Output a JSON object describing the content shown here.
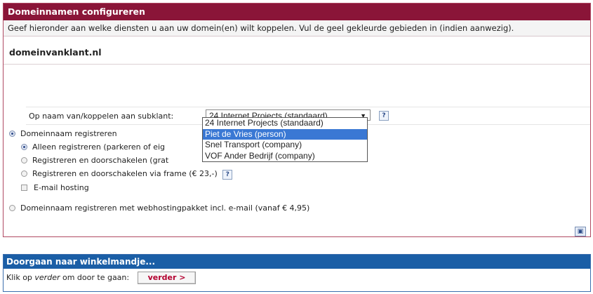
{
  "config": {
    "title": "Domeinnamen configureren",
    "intro": "Geef hieronder aan welke diensten u aan uw domein(en) wilt koppelen. Vul de geel gekleurde gebieden in (indien aanwezig).",
    "domain": "domeinvanklant.nl",
    "subclient_label": "Op naam van/koppelen aan subklant:",
    "subclient_selected": "24 Internet Projects (standaard)",
    "subclient_options": [
      "24 Internet Projects (standaard)",
      "Piet de Vries (person)",
      "Snel Transport (company)",
      "VOF Ander Bedrijf (company)"
    ],
    "help_glyph": "?",
    "opt_register": "Domeinnaam registreren",
    "opt_park": "Alleen registreren (parkeren of eig",
    "opt_forward": "Registreren en doorschakelen (grat",
    "opt_frame": "Registreren en doorschakelen via frame (€ 23,-)",
    "opt_email": "E-mail hosting",
    "opt_hosting": "Domeinnaam registreren met webhostingpakket incl. e-mail (vanaf € 4,95)"
  },
  "cart": {
    "title": "Doorgaan naar winkelmandje...",
    "text_before": "Klik op ",
    "text_em": "verder",
    "text_after": " om door te gaan:",
    "button": "verder >"
  },
  "colors": {
    "config_header": "#8a1538",
    "cart_header": "#1a5ea6",
    "highlight": "#3a78d4"
  }
}
